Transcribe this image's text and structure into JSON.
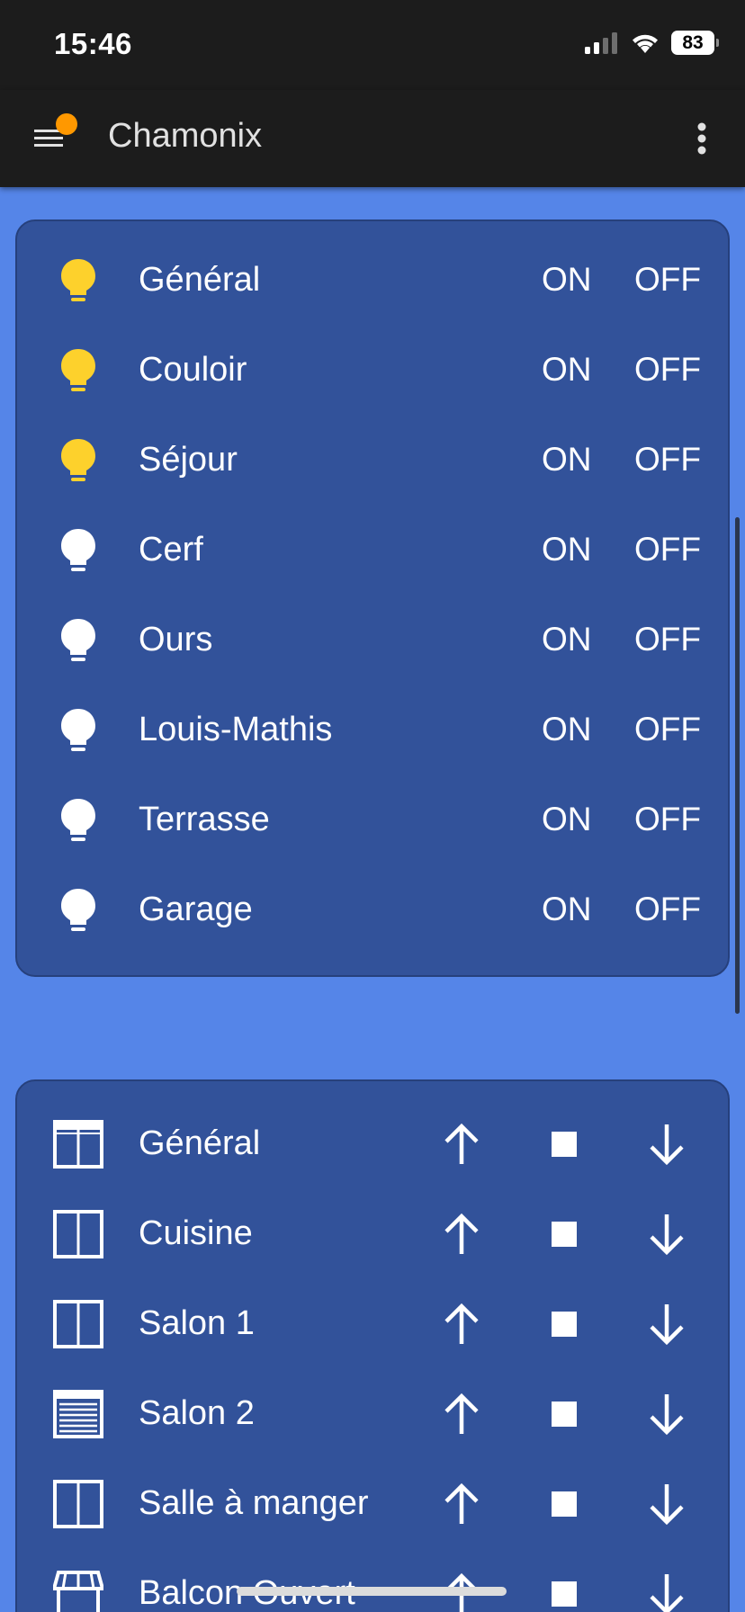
{
  "status_bar": {
    "time": "15:46",
    "battery": "83"
  },
  "app_bar": {
    "title": "Chamonix"
  },
  "lights": {
    "on_label": "ON",
    "off_label": "OFF",
    "active_color": "#fdd12c",
    "inactive_color": "#ffffff",
    "items": [
      {
        "label": "Général",
        "active": true
      },
      {
        "label": "Couloir",
        "active": true
      },
      {
        "label": "Séjour",
        "active": true
      },
      {
        "label": "Cerf",
        "active": false
      },
      {
        "label": "Ours",
        "active": false
      },
      {
        "label": "Louis-Mathis",
        "active": false
      },
      {
        "label": "Terrasse",
        "active": false
      },
      {
        "label": "Garage",
        "active": false
      }
    ]
  },
  "covers": {
    "items": [
      {
        "label": "Général",
        "icon": "window-shutter-open-icon"
      },
      {
        "label": "Cuisine",
        "icon": "window-open-icon"
      },
      {
        "label": "Salon 1",
        "icon": "window-open-icon"
      },
      {
        "label": "Salon 2",
        "icon": "window-shutter-icon"
      },
      {
        "label": "Salle à manger",
        "icon": "window-open-icon"
      },
      {
        "label": "Balcon Ouvert",
        "icon": "awning-icon"
      }
    ]
  }
}
